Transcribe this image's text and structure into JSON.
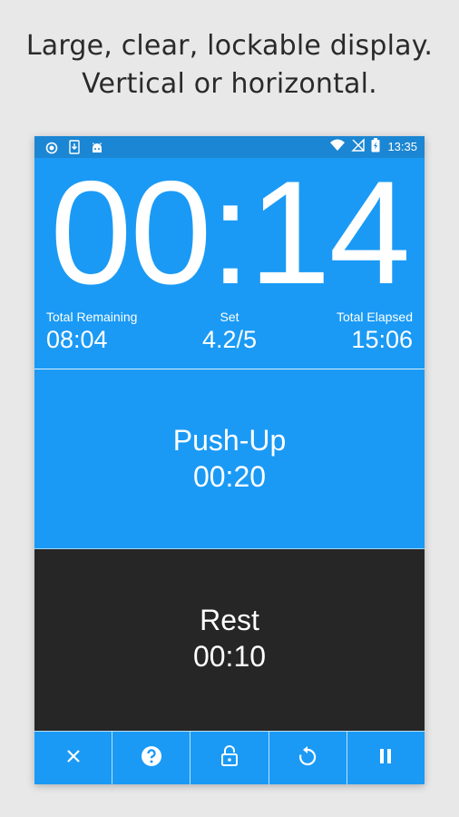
{
  "caption": {
    "line1": "Large, clear, lockable display.",
    "line2": "Vertical or horizontal."
  },
  "status_bar": {
    "time": "13:35",
    "left_icons": [
      "record-icon",
      "download-icon",
      "android-icon"
    ],
    "right_icons": [
      "wifi-icon",
      "no-signal-icon",
      "battery-charging-icon"
    ]
  },
  "timer": {
    "display": "00:14"
  },
  "stats": {
    "total_remaining_label": "Total Remaining",
    "total_remaining_value": "08:04",
    "set_label": "Set",
    "set_value": "4.2/5",
    "total_elapsed_label": "Total Elapsed",
    "total_elapsed_value": "15:06"
  },
  "current_interval": {
    "name": "Push-Up",
    "time": "00:20"
  },
  "next_interval": {
    "name": "Rest",
    "time": "00:10"
  },
  "toolbar": {
    "buttons": [
      "close-icon",
      "help-icon",
      "lock-icon",
      "restart-icon",
      "pause-icon"
    ]
  },
  "colors": {
    "primary_blue": "#1a9af5",
    "status_bar_blue": "#1b86d3",
    "rest_dark": "#262626",
    "page_background": "#e8e8e8"
  }
}
